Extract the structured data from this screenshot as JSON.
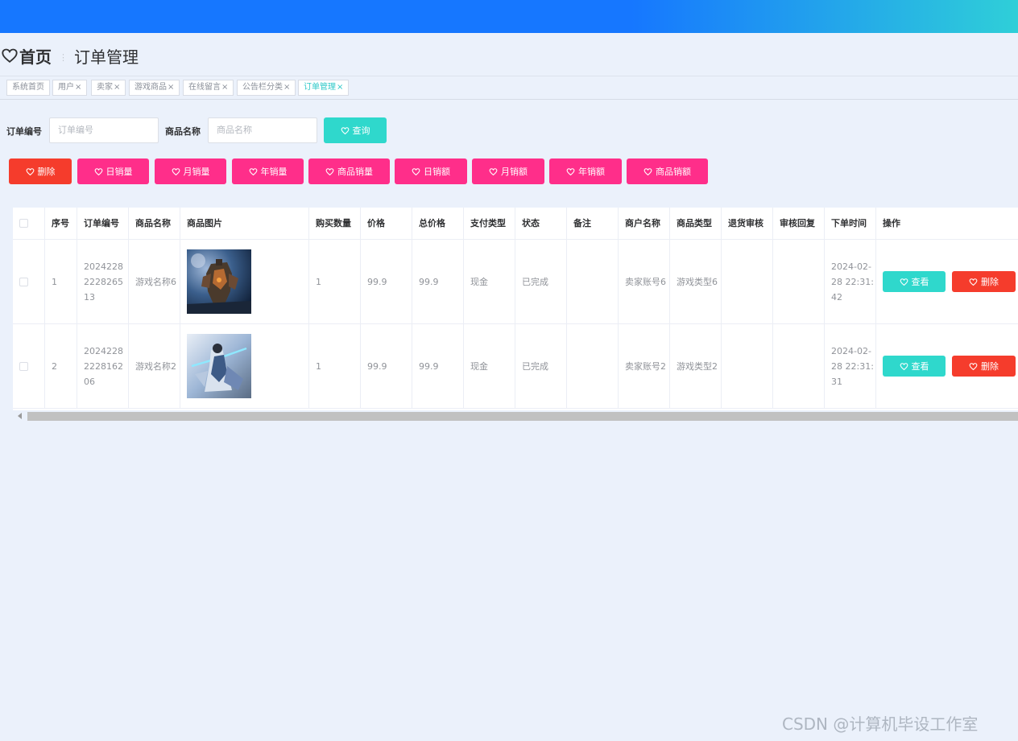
{
  "breadcrumb": {
    "home": "首页",
    "current": "订单管理"
  },
  "tabs": [
    {
      "label": "系统首页",
      "closable": false
    },
    {
      "label": "用户",
      "closable": true
    },
    {
      "label": "卖家",
      "closable": true
    },
    {
      "label": "游戏商品",
      "closable": true
    },
    {
      "label": "在线留言",
      "closable": true
    },
    {
      "label": "公告栏分类",
      "closable": true
    },
    {
      "label": "订单管理",
      "closable": true,
      "active": true
    }
  ],
  "tab_close_glyph": "×",
  "search": {
    "order_no_label": "订单编号",
    "order_no_placeholder": "订单编号",
    "product_name_label": "商品名称",
    "product_name_placeholder": "商品名称",
    "query_button": "查询"
  },
  "toolbar": {
    "delete": "删除",
    "daily_sales_qty": "日销量",
    "monthly_sales_qty": "月销量",
    "yearly_sales_qty": "年销量",
    "product_sales_qty": "商品销量",
    "daily_sales_amt": "日销额",
    "monthly_sales_amt": "月销额",
    "yearly_sales_amt": "年销额",
    "product_sales_amt": "商品销额"
  },
  "table": {
    "headers": {
      "index": "序号",
      "order_no": "订单编号",
      "product_name": "商品名称",
      "product_image": "商品图片",
      "quantity": "购买数量",
      "price": "价格",
      "total": "总价格",
      "payment": "支付类型",
      "status": "状态",
      "remark": "备注",
      "merchant": "商户名称",
      "category": "商品类型",
      "refund_review": "退货审核",
      "review_reply": "审核回复",
      "order_time": "下单时间",
      "actions": "操作"
    },
    "rows": [
      {
        "index": "1",
        "order_no": "202422822282651 3",
        "order_no_lines": [
          "2024228",
          "2228265",
          "13"
        ],
        "product_name": "游戏名称6",
        "quantity": "1",
        "price": "99.9",
        "total": "99.9",
        "payment": "现金",
        "status": "已完成",
        "remark": "",
        "merchant": "卖家账号6",
        "category": "游戏类型6",
        "refund_review": "",
        "review_reply": "",
        "order_time": "2024-02-28 22:31:42",
        "image_icon": "mech-warrior-game-art"
      },
      {
        "index": "2",
        "order_no": "2024228222816206",
        "order_no_lines": [
          "2024228",
          "2228162",
          "06"
        ],
        "product_name": "游戏名称2",
        "quantity": "1",
        "price": "99.9",
        "total": "99.9",
        "payment": "现金",
        "status": "已完成",
        "remark": "",
        "merchant": "卖家账号2",
        "category": "游戏类型2",
        "refund_review": "",
        "review_reply": "",
        "order_time": "2024-02-28 22:31:31",
        "image_icon": "swordsman-game-art"
      }
    ],
    "view_button": "查看",
    "delete_button": "删除"
  },
  "watermark": "CSDN @计算机毕设工作室",
  "colors": {
    "header_gradient_start": "#1677ff",
    "header_gradient_end": "#2fcfd8",
    "page_bg": "#ebf1fb",
    "cyan": "#2fd8cc",
    "red": "#f53c2c",
    "pink": "#ff2e8a",
    "active_tab": "#2ec8c8"
  }
}
